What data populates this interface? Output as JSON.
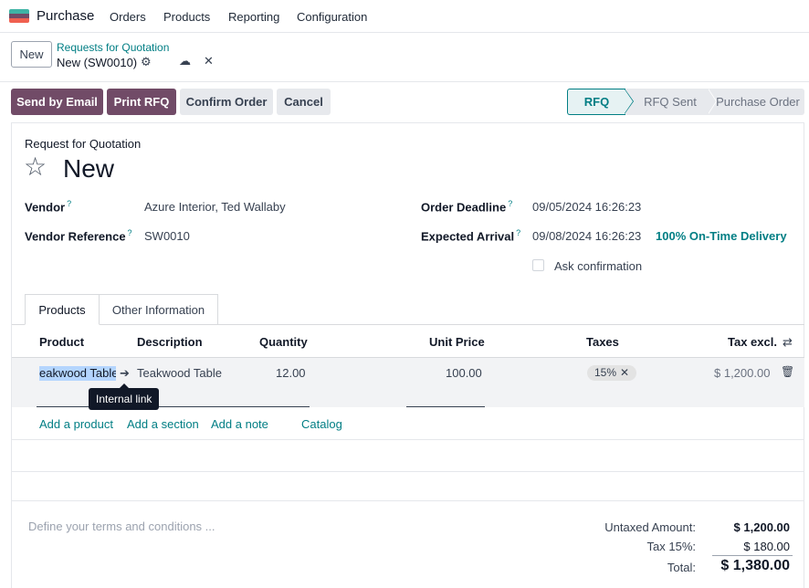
{
  "nav": {
    "app_name": "Purchase",
    "items": [
      "Orders",
      "Products",
      "Reporting",
      "Configuration"
    ],
    "logo_colors": [
      "#3fb4a5",
      "#714b67",
      "#f06050"
    ]
  },
  "control_panel": {
    "new_label": "New",
    "breadcrumb_parent": "Requests for Quotation",
    "breadcrumb_current": "New (SW0010)",
    "gear_icon": "⚙",
    "save_icon": "☁",
    "discard_icon": "✕"
  },
  "actions": {
    "send_email": "Send by Email",
    "print_rfq": "Print RFQ",
    "confirm_order": "Confirm Order",
    "cancel": "Cancel"
  },
  "statusbar": {
    "stages": [
      "RFQ",
      "RFQ Sent",
      "Purchase Order"
    ],
    "active": "RFQ",
    "accent": "#017e84"
  },
  "form": {
    "doc_type": "Request for Quotation",
    "name": "New",
    "star_icon": "☆",
    "help_mark": "?",
    "vendor_label": "Vendor",
    "vendor_value": "Azure Interior, Ted Wallaby",
    "vendor_ref_label": "Vendor Reference",
    "vendor_ref_value": "SW0010",
    "deadline_label": "Order Deadline",
    "deadline_value": "09/05/2024 16:26:23",
    "arrival_label": "Expected Arrival",
    "arrival_value": "09/08/2024 16:26:23",
    "on_time": "100% On-Time Delivery",
    "ask_confirmation": "Ask confirmation"
  },
  "tabs": [
    "Products",
    "Other Information"
  ],
  "table": {
    "headers": {
      "product": "Product",
      "description": "Description",
      "quantity": "Quantity",
      "unit_price": "Unit Price",
      "taxes": "Taxes",
      "tax_excl": "Tax excl."
    },
    "rows": [
      {
        "product": "eakwood Table",
        "description": "Teakwood Table",
        "quantity": "12.00",
        "unit_price": "100.00",
        "tax": "15%",
        "tax_remove": "✕",
        "subtotal": "$ 1,200.00"
      }
    ],
    "tooltip": "Internal link",
    "link_icon": "➔",
    "trash_icon": "🗑",
    "settings_icon": "⇄"
  },
  "add_links": {
    "product": "Add a product",
    "section": "Add a section",
    "note": "Add a note",
    "catalog": "Catalog"
  },
  "footer": {
    "terms_placeholder": "Define your terms and conditions ...",
    "untaxed_label": "Untaxed Amount:",
    "untaxed_value": "$ 1,200.00",
    "tax_label": "Tax 15%:",
    "tax_value": "$ 180.00",
    "total_label": "Total:",
    "total_value": "$ 1,380.00"
  }
}
